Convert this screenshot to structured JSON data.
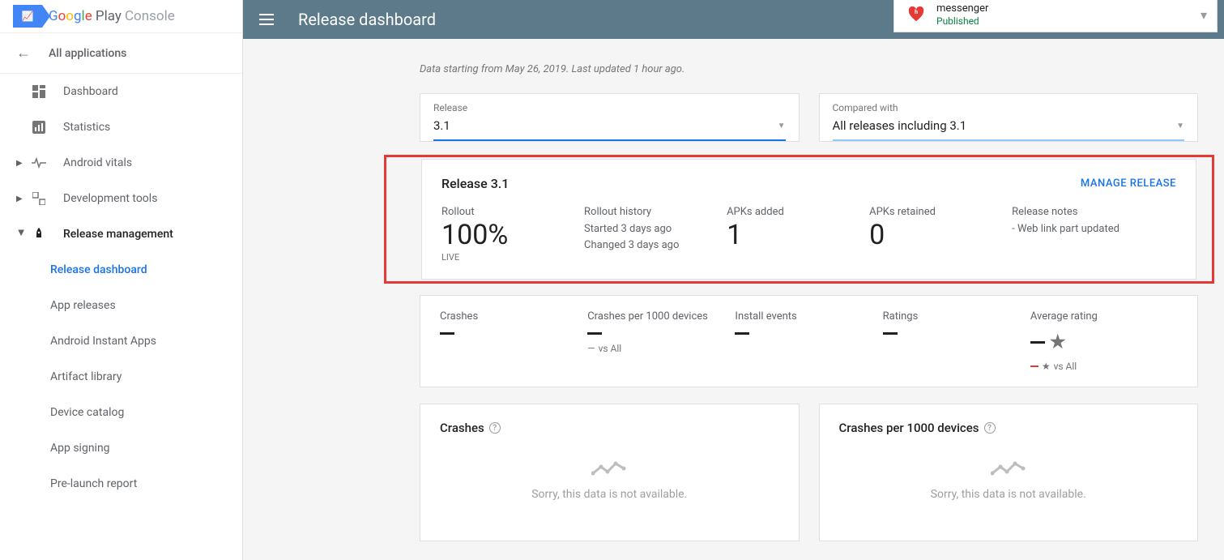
{
  "brand": {
    "name": "Google Play",
    "console": "Console"
  },
  "header": {
    "title": "Release dashboard"
  },
  "appSelector": {
    "name": "messenger",
    "status": "Published"
  },
  "nav": {
    "back": "All applications",
    "items": [
      "Dashboard",
      "Statistics",
      "Android vitals",
      "Development tools",
      "Release management"
    ],
    "subs": [
      "Release dashboard",
      "App releases",
      "Android Instant Apps",
      "Artifact library",
      "Device catalog",
      "App signing",
      "Pre-launch report"
    ]
  },
  "dataNote": "Data starting from May 26, 2019. Last updated 1 hour ago.",
  "filters": {
    "releaseLabel": "Release",
    "releaseValue": "3.1",
    "comparedLabel": "Compared with",
    "comparedValue": "All releases including 3.1"
  },
  "release": {
    "title": "Release 3.1",
    "manage": "MANAGE RELEASE",
    "rolloutLabel": "Rollout",
    "rolloutValue": "100%",
    "rolloutLive": "LIVE",
    "historyLabel": "Rollout history",
    "historyStarted": "Started 3 days ago",
    "historyChanged": "Changed 3 days ago",
    "apksAddedLabel": "APKs added",
    "apksAddedValue": "1",
    "apksRetainedLabel": "APKs retained",
    "apksRetainedValue": "0",
    "notesLabel": "Release notes",
    "notesValue": "- Web link part updated"
  },
  "metrics": {
    "crashes": "Crashes",
    "crashesPer1000": "Crashes per 1000 devices",
    "installEvents": "Install events",
    "ratings": "Ratings",
    "avgRating": "Average rating",
    "vsAll": "vs All"
  },
  "charts": {
    "crashes": "Crashes",
    "crashesPer1000": "Crashes per 1000 devices",
    "noData": "Sorry, this data is not available."
  }
}
